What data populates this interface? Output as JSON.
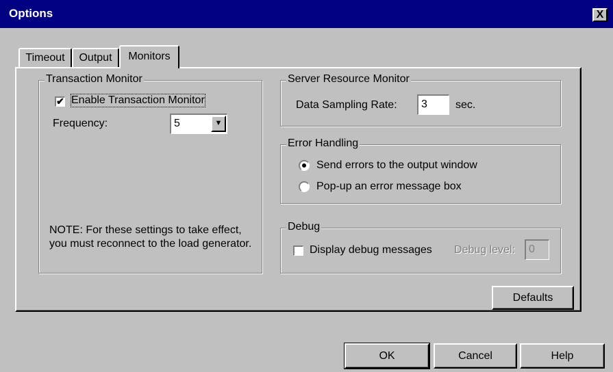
{
  "window": {
    "title": "Options",
    "close_label": "X"
  },
  "tabs": [
    {
      "label": "Timeout"
    },
    {
      "label": "Output"
    },
    {
      "label": "Monitors"
    }
  ],
  "transaction_monitor": {
    "legend": "Transaction Monitor",
    "enable_label": "Enable Transaction Monitor",
    "enable_checked": "✔",
    "frequency_label": "Frequency:",
    "frequency_value": "5",
    "dropdown_arrow": "▼",
    "note": "NOTE: For these settings to take effect, you must reconnect to the load generator."
  },
  "server_resource_monitor": {
    "legend": "Server Resource Monitor",
    "sampling_label": "Data Sampling Rate:",
    "sampling_value": "3",
    "unit": "sec."
  },
  "error_handling": {
    "legend": "Error Handling",
    "options": [
      {
        "label": "Send errors to the output window",
        "selected": true
      },
      {
        "label": "Pop-up an error message box",
        "selected": false
      }
    ]
  },
  "debug": {
    "legend": "Debug",
    "display_label": "Display debug messages",
    "level_label": "Debug level:",
    "level_value": "0"
  },
  "buttons": {
    "defaults": "Defaults",
    "ok": "OK",
    "cancel": "Cancel",
    "help": "Help"
  }
}
